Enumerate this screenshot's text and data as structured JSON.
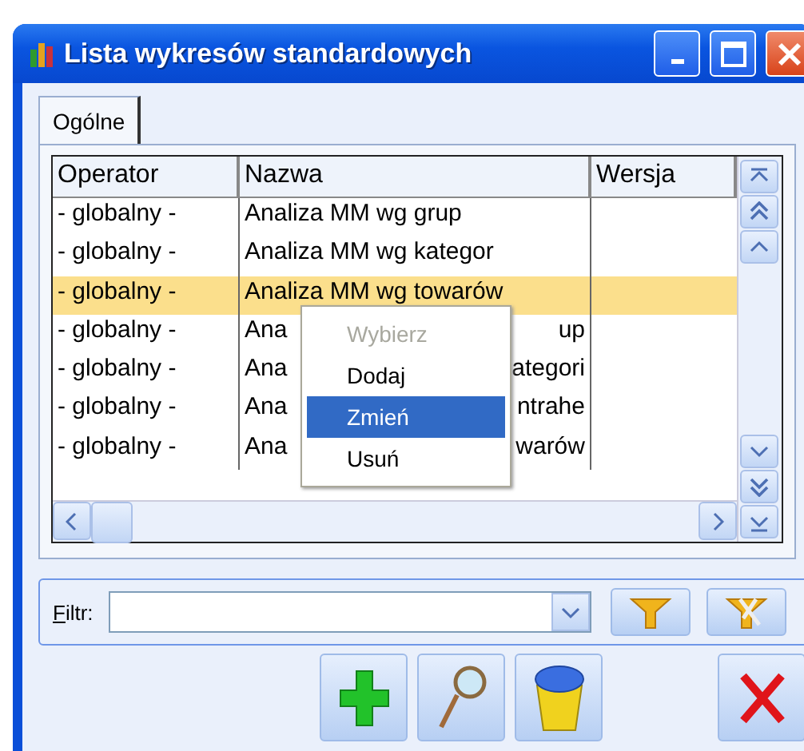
{
  "window": {
    "title": "Lista wykresów standardowych"
  },
  "tabs": [
    {
      "label": "Ogólne",
      "selected": true
    }
  ],
  "table": {
    "columns": [
      "Operator",
      "Nazwa",
      "Wersja"
    ],
    "rows": [
      {
        "operator": "- globalny -",
        "name": "Analiza MM wg grup",
        "selected": false
      },
      {
        "operator": "- globalny -",
        "name": "Analiza MM wg kategor",
        "selected": false
      },
      {
        "operator": "- globalny -",
        "name": "Analiza MM wg towarów",
        "selected": true
      },
      {
        "operator": "- globalny -",
        "name": "Ana",
        "name_end": "up",
        "selected": false
      },
      {
        "operator": "- globalny -",
        "name": "Ana",
        "name_end": "ategori",
        "selected": false
      },
      {
        "operator": "- globalny -",
        "name": "Ana",
        "name_end": "ntrahe",
        "selected": false
      },
      {
        "operator": "- globalny -",
        "name": "Ana",
        "name_end": "warów",
        "selected": false
      }
    ]
  },
  "context_menu": {
    "items": [
      {
        "label": "Wybierz",
        "disabled": true,
        "selected": false
      },
      {
        "label": "Dodaj",
        "disabled": false,
        "selected": false
      },
      {
        "label": "Zmień",
        "disabled": false,
        "selected": true
      },
      {
        "label": "Usuń",
        "disabled": false,
        "selected": false
      }
    ]
  },
  "filter": {
    "label": "Filtr:"
  }
}
